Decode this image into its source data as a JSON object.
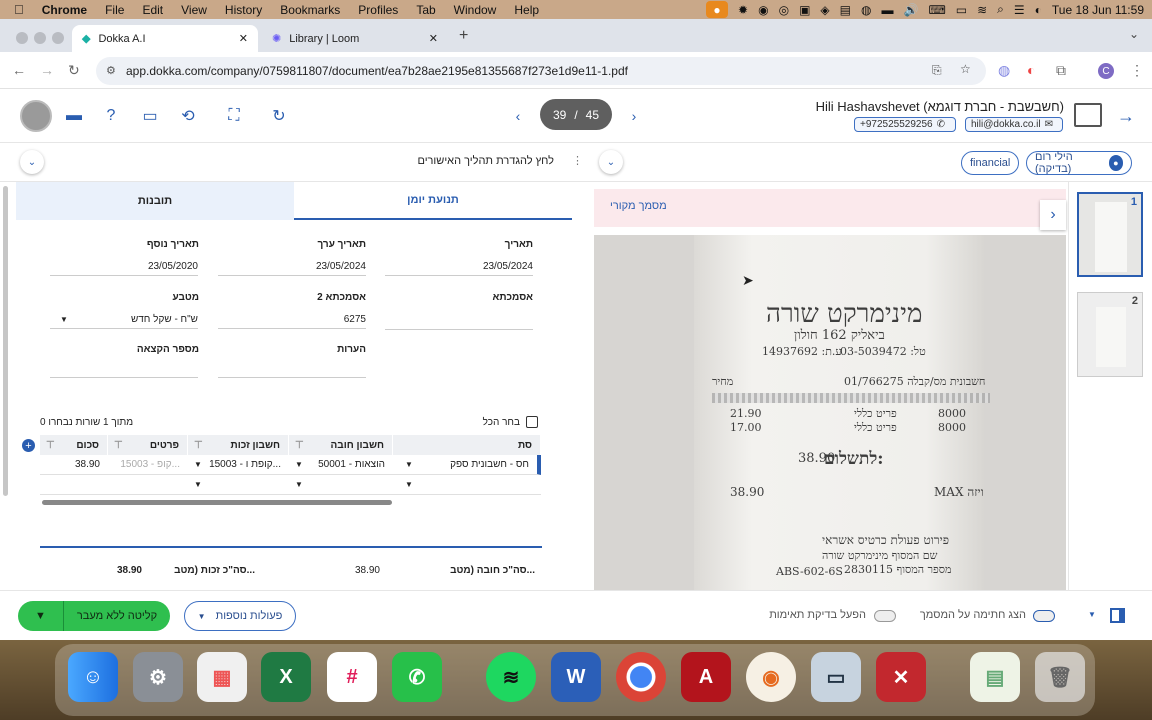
{
  "menubar": {
    "apple": "",
    "app": "Chrome",
    "items": [
      "File",
      "Edit",
      "View",
      "History",
      "Bookmarks",
      "Profiles",
      "Tab",
      "Window",
      "Help"
    ],
    "datetime": "Tue 18 Jun  11:59"
  },
  "browser": {
    "tabs": [
      {
        "title": "Dokka A.I",
        "active": true
      },
      {
        "title": "Library | Loom",
        "active": false
      }
    ],
    "url": "app.dokka.com/company/0759811807/document/ea7b28ae2195e81355687f273e1d9e11-1.pdf"
  },
  "header": {
    "page_current": "39",
    "page_sep": "/",
    "page_total": "45",
    "company": "Hili Hashavshevet (חשבשבת - חברת דוגמא)",
    "phone": "+972525529256",
    "email": "hili@dokka.co.il"
  },
  "subheader": {
    "approval_text": "לחץ להגדרת תהליך האישורים",
    "user_pill": "הילי רום (בדיקה)",
    "tag_pill": "financial"
  },
  "form": {
    "tabs": [
      "תנועת יומן",
      "תובנות"
    ],
    "fields": {
      "date_label": "תאריך",
      "date_value": "23/05/2024",
      "value_date_label": "תאריך ערך",
      "value_date_value": "23/05/2024",
      "extra_date_label": "תאריך נוסף",
      "extra_date_value": "23/05/2020",
      "ref_label": "אסמכתא",
      "ref_value": "",
      "ref2_label": "אסמכתא 2",
      "ref2_value": "6275",
      "currency_label": "מטבע",
      "currency_value": "ש\"ח - שקל חדש",
      "notes_label": "הערות",
      "batch_label": "מספר הקצאה"
    },
    "select_all": "בחר הכל",
    "selected_count": "0 מתוך 1 שורות נבחרו"
  },
  "grid": {
    "headers": {
      "type": "סת",
      "debit": "חשבון חובה",
      "credit": "חשבון זכות",
      "details": "פרטים",
      "amount": "סכום"
    },
    "row": {
      "type": "חס - חשבונית ספק",
      "debit": "50001 - הוצאות",
      "credit": "15003 - קופת ו...",
      "details": "15003 - קופ...",
      "amount": "38.90"
    }
  },
  "totals": {
    "debit_label": "סה\"כ חובה (מטב...",
    "debit_value": "38.90",
    "credit_label": "סה\"כ זכות (מטב...",
    "credit_value": "38.90"
  },
  "document": {
    "banner": "מסמך מקורי",
    "store": "מינימרקט שורה",
    "address": "ביאליק 162 חולון",
    "phone": "טל: 03-5039472",
    "taxid": "ע.ת: 14937692",
    "invoice": "חשבונית מס/קבלה 01/766275",
    "col_price": "מחיר",
    "col_item": "פריט",
    "item1_code": "8000",
    "item1_name": "פריט כללי",
    "item1_price": "21.90",
    "item2_code": "8000",
    "item2_name": "פריט כללי",
    "item2_price": "17.00",
    "total_label": "לתשלום:",
    "total_value": "38.90",
    "max_label": "MAX ויזה",
    "max_value": "38.90",
    "card_title": "פירוט פעולת כרטיס אשראי",
    "card_l1": "שם המסוף   מינימרקט שורה",
    "card_l2": "מספר המסוף   2830115",
    "card_l3": "ABS-602-6S"
  },
  "thumbs": [
    "1",
    "2"
  ],
  "bottom": {
    "save_btn": "קליטה ללא מעבר",
    "more_btn": "פעולות נוספות",
    "match_toggle": "הפעל בדיקת תאימות",
    "stamp_toggle": "הצג חתימה על המסמך"
  },
  "colors": {
    "accent": "#2a5db0",
    "green": "#2fbf4f",
    "banner": "#fbe9ec"
  }
}
